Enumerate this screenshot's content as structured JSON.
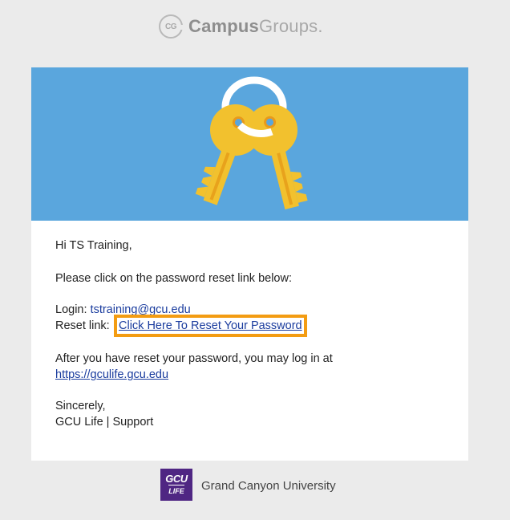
{
  "header": {
    "logo_mark": "CG",
    "brand_bold": "Campus",
    "brand_light": "Groups",
    "brand_dot": "."
  },
  "email": {
    "greeting": "Hi TS Training,",
    "intro": "Please click on the password reset link below:",
    "login_label": "Login:",
    "login_value": "tstraining@gcu.edu",
    "reset_label": "Reset link:",
    "reset_link_text": "Click Here To Reset Your Password",
    "after_text": "After you have reset your password, you may log in at",
    "login_url": "https://gculife.gcu.edu",
    "closing": "Sincerely,",
    "signature": "GCU Life | Support"
  },
  "footer": {
    "logo_line1": "GCU",
    "logo_line2": "LIFE",
    "university": "Grand Canyon University"
  },
  "colors": {
    "banner": "#5aa6dd",
    "highlight": "#f39c12",
    "link": "#1a3c9e",
    "key": "#f2c12e"
  }
}
